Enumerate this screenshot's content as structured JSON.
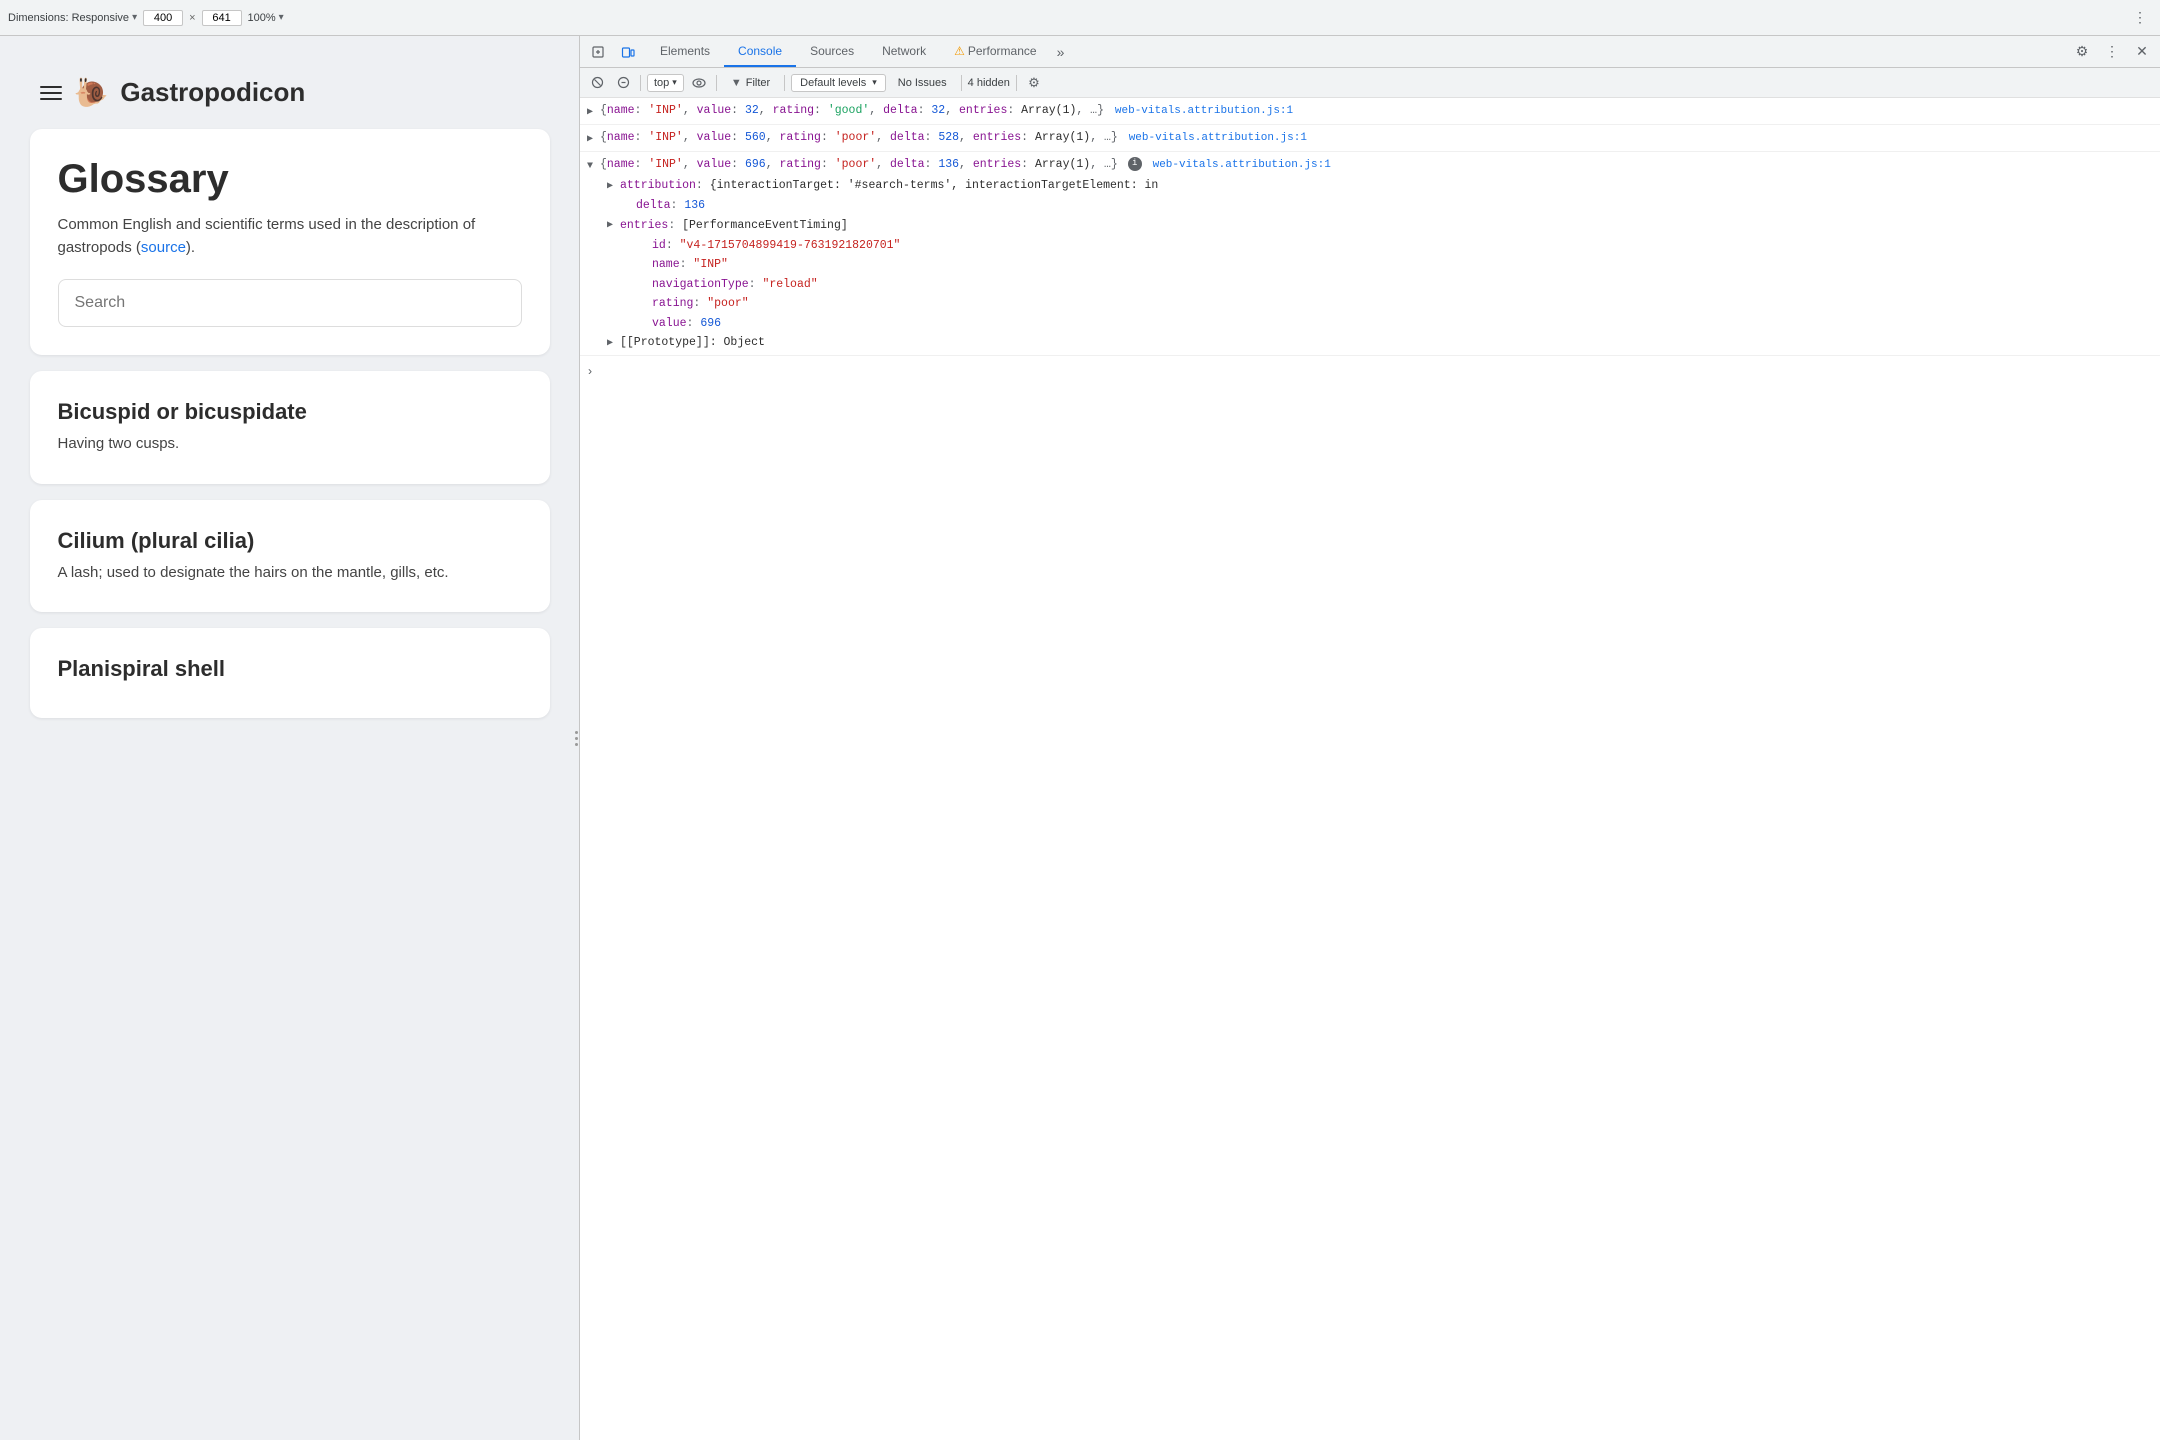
{
  "topbar": {
    "dimensions_label": "Dimensions: Responsive",
    "width": "400",
    "height": "641",
    "zoom": "100%",
    "more_options": "⋮"
  },
  "app": {
    "title": "Gastropodicon",
    "logo": "🐌",
    "glossary": {
      "title": "Glossary",
      "description": "Common English and scientific terms used in the description of gastropods (",
      "source_link": "source",
      "description_end": ").",
      "search_placeholder": "Search"
    },
    "terms": [
      {
        "title": "Bicuspid or bicuspidate",
        "description": "Having two cusps."
      },
      {
        "title": "Cilium (plural cilia)",
        "description": "A lash; used to designate the hairs on the mantle, gills, etc."
      },
      {
        "title": "Planispiral shell",
        "description": ""
      }
    ]
  },
  "devtools": {
    "tabs": [
      "Elements",
      "Console",
      "Sources",
      "Network",
      "Performance"
    ],
    "active_tab": "Console",
    "overflow_icon": "»",
    "top_context": "top",
    "filter_label": "Filter",
    "levels_label": "Default levels",
    "no_issues_label": "No Issues",
    "hidden_count": "4 hidden",
    "console_entries": [
      {
        "id": "entry1",
        "collapsed": true,
        "source": "web-vitals.attribution.js:1",
        "line": "{name: 'INP', value: 32, rating: 'good', delta: 32, entries: Array(1), …}"
      },
      {
        "id": "entry2",
        "collapsed": true,
        "source": "web-vitals.attribution.js:1",
        "line": "{name: 'INP', value: 560, rating: 'poor', delta: 528, entries: Array(1), …}"
      },
      {
        "id": "entry3",
        "collapsed": false,
        "source": "web-vitals.attribution.js:1",
        "line": "{name: 'INP', value: 696, rating: 'poor', delta: 136, entries: Array(1), …}",
        "info_btn": true,
        "properties": [
          {
            "key": "attribution",
            "value_text": "{interactionTarget: '#search-terms', interactionTargetElement: in",
            "has_children": true
          },
          {
            "key": "delta",
            "value_text": "136",
            "type": "num",
            "has_children": false
          },
          {
            "key": "entries",
            "value_text": "[PerformanceEventTiming]",
            "has_children": true
          }
        ],
        "nested_props": [
          {
            "key": "id",
            "value": "\"v4-1715704899419-7631921820701\"",
            "type": "str"
          },
          {
            "key": "name",
            "value": "\"INP\"",
            "type": "str"
          },
          {
            "key": "navigationType",
            "value": "\"reload\"",
            "type": "str"
          },
          {
            "key": "rating",
            "value": "\"poor\"",
            "type": "str"
          },
          {
            "key": "value",
            "value": "696",
            "type": "num"
          }
        ],
        "prototype_row": "[[Prototype]]: Object"
      }
    ],
    "console_input_placeholder": ""
  }
}
